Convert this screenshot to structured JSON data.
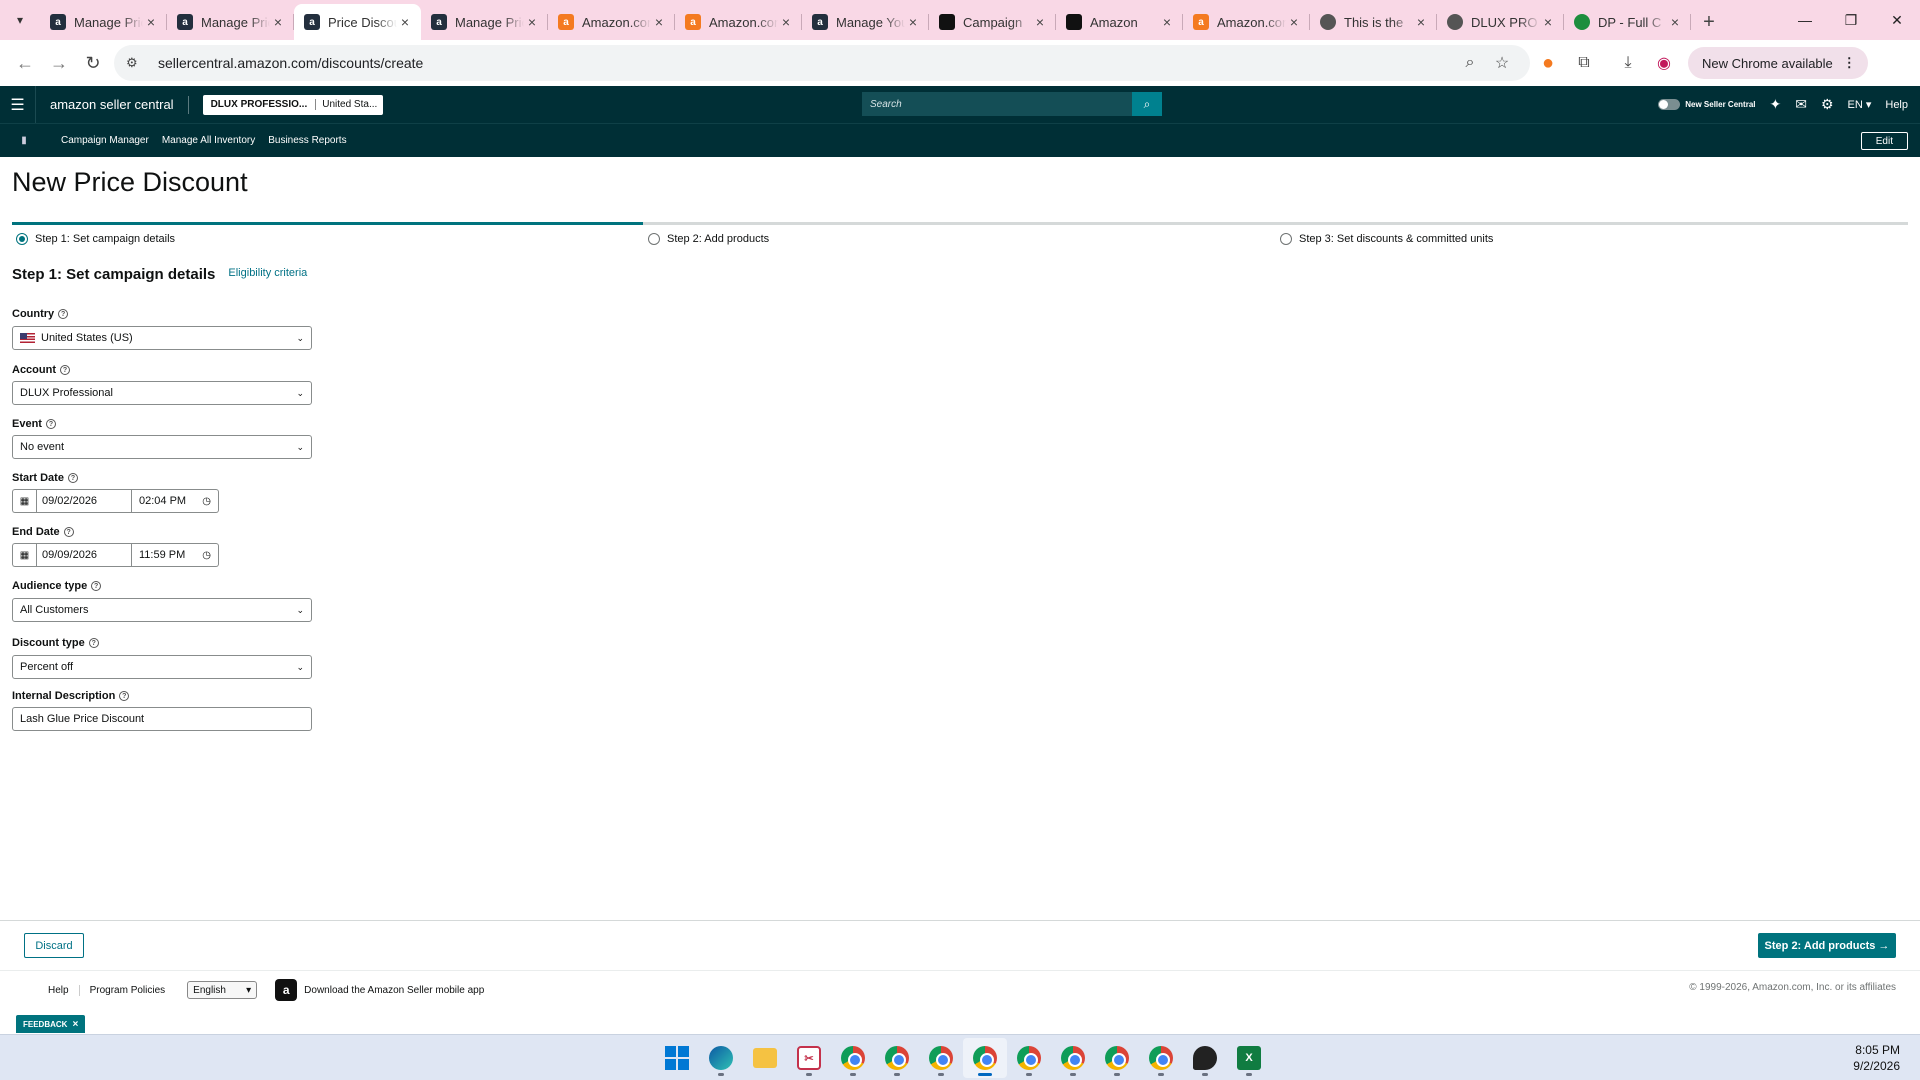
{
  "browser": {
    "tabs": [
      {
        "title": "Manage Pricing",
        "favicon": "amazon-icon",
        "active": false
      },
      {
        "title": "Manage Pricing",
        "favicon": "amazon-icon",
        "active": false
      },
      {
        "title": "Price Discounts",
        "favicon": "amazon-icon",
        "active": true
      },
      {
        "title": "Manage Pricing",
        "favicon": "amazon-icon",
        "active": false
      },
      {
        "title": "Amazon.com",
        "favicon": "amazon-orange-icon",
        "active": false
      },
      {
        "title": "Amazon.com",
        "favicon": "amazon-orange-icon",
        "active": false
      },
      {
        "title": "Manage Your",
        "favicon": "amazon-icon",
        "active": false
      },
      {
        "title": "Campaign",
        "favicon": "campaign-icon",
        "active": false
      },
      {
        "title": "Amazon",
        "favicon": "campaign-icon",
        "active": false
      },
      {
        "title": "Amazon.com",
        "favicon": "amazon-orange-icon",
        "active": false
      },
      {
        "title": "This is the",
        "favicon": "circle-icon",
        "active": false
      },
      {
        "title": "DLUX PRO",
        "favicon": "circle-icon",
        "active": false
      },
      {
        "title": "DP - Full C",
        "favicon": "sheets-icon",
        "active": false
      }
    ],
    "url": "sellercentral.amazon.com/discounts/create",
    "new_chrome_label": "New Chrome available"
  },
  "header": {
    "logo_text": "amazon seller central",
    "account_name": "DLUX PROFESSIO...",
    "marketplace": "United Sta...",
    "search_placeholder": "Search",
    "new_seller_central_label": "New Seller Central",
    "language": "EN",
    "help_label": "Help"
  },
  "nav": {
    "links": [
      "Campaign Manager",
      "Manage All Inventory",
      "Business Reports"
    ],
    "edit_label": "Edit"
  },
  "page": {
    "title": "New Price Discount",
    "steps": [
      {
        "label": "Step 1: Set campaign details",
        "selected": true
      },
      {
        "label": "Step 2: Add products",
        "selected": false
      },
      {
        "label": "Step 3: Set discounts & committed units",
        "selected": false
      }
    ],
    "progress_fraction": 0.333,
    "section_title": "Step 1: Set campaign details",
    "eligibility_link": "Eligibility criteria"
  },
  "form": {
    "country": {
      "label": "Country",
      "value": "United States (US)"
    },
    "account": {
      "label": "Account",
      "value": "DLUX Professional"
    },
    "event": {
      "label": "Event",
      "value": "No event"
    },
    "start_date": {
      "label": "Start Date",
      "date": "09/02/2026",
      "time": "02:04 PM"
    },
    "end_date": {
      "label": "End Date",
      "date": "09/09/2026",
      "time": "11:59 PM"
    },
    "audience_type": {
      "label": "Audience type",
      "value": "All Customers"
    },
    "discount_type": {
      "label": "Discount type",
      "value": "Percent off"
    },
    "internal_description": {
      "label": "Internal Description",
      "value": "Lash Glue Price Discount"
    }
  },
  "actions": {
    "discard_label": "Discard",
    "next_label": "Step 2: Add products"
  },
  "footer": {
    "help_label": "Help",
    "policies_label": "Program Policies",
    "language_value": "English",
    "app_link": "Download the Amazon Seller mobile app",
    "copyright": "© 1999-2026, Amazon.com, Inc. or its affiliates",
    "feedback_label": "FEEDBACK"
  },
  "taskbar": {
    "time": "8:05 PM",
    "date": "9/2/2026"
  },
  "colors": {
    "header_bg": "#002f36",
    "accent": "#00737e",
    "tabstrip_bg": "#f9d8e6"
  }
}
